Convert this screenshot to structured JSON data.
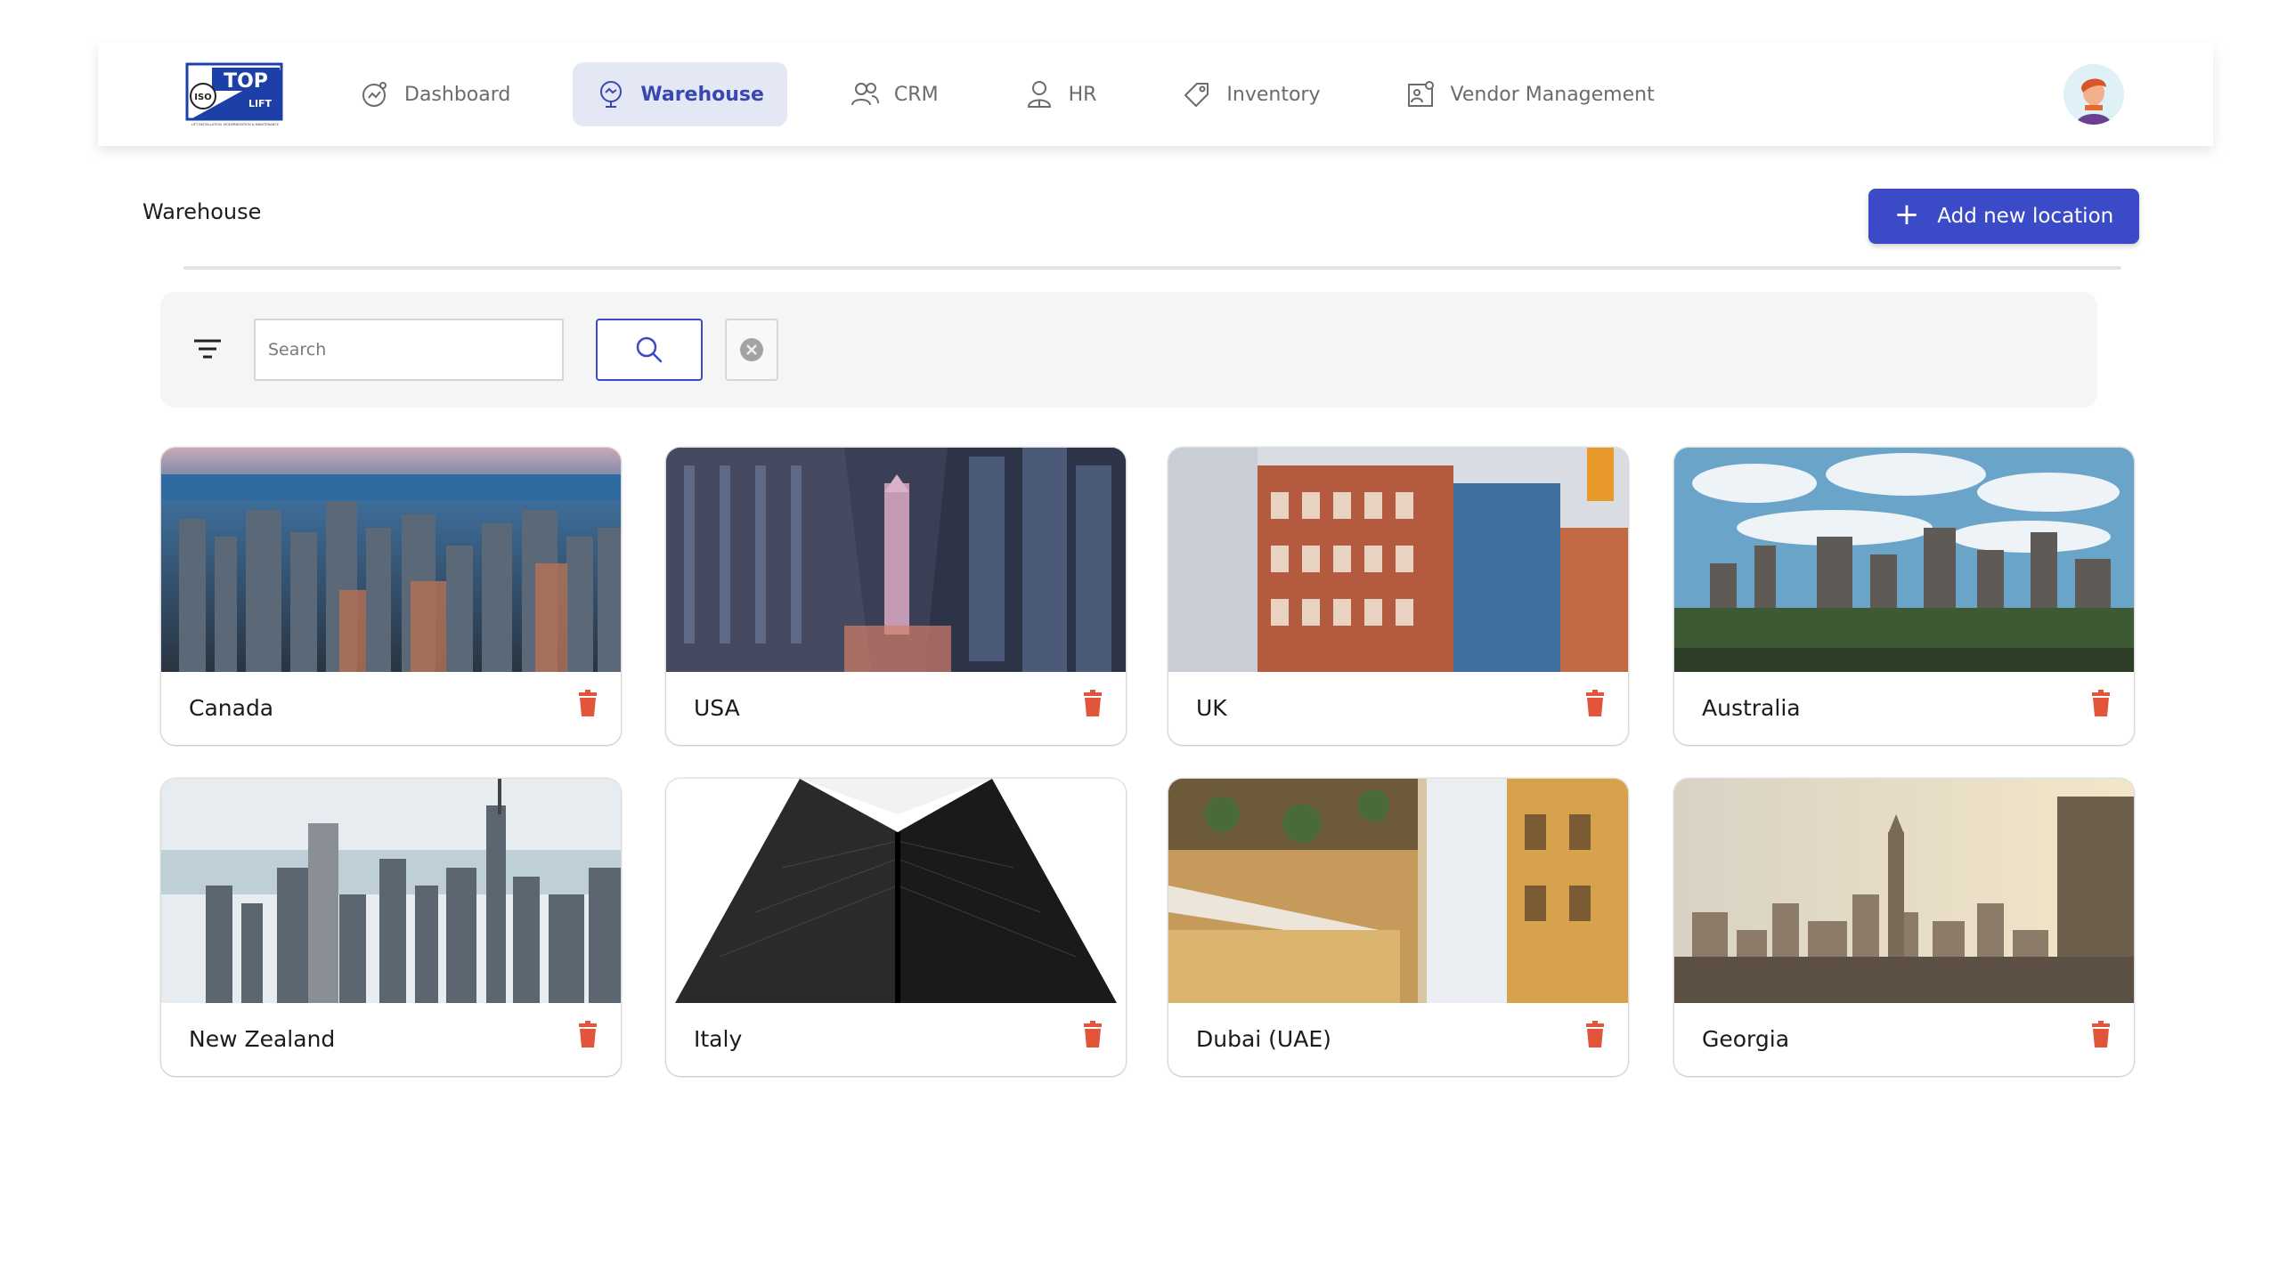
{
  "app": {
    "logo_text": "TOP",
    "logo_subtext": "LIFT",
    "logo_badge": "ISO",
    "logo_tagline": "LIFT INSTALLATION, MODERNIZATION & MAINTENANCE"
  },
  "nav": {
    "items": [
      {
        "label": "Dashboard",
        "icon": "dashboard-icon",
        "active": false
      },
      {
        "label": "Warehouse",
        "icon": "warehouse-icon",
        "active": true
      },
      {
        "label": "CRM",
        "icon": "users-icon",
        "active": false
      },
      {
        "label": "HR",
        "icon": "person-icon",
        "active": false
      },
      {
        "label": "Inventory",
        "icon": "tag-icon",
        "active": false
      },
      {
        "label": "Vendor Management",
        "icon": "vendor-icon",
        "active": false
      }
    ]
  },
  "page": {
    "title": "Warehouse",
    "add_button_label": "Add new location"
  },
  "filters": {
    "search_placeholder": "Search",
    "search_value": ""
  },
  "locations": [
    {
      "name": "Canada",
      "image": "city-skyline-lake"
    },
    {
      "name": "USA",
      "image": "downtown-street"
    },
    {
      "name": "UK",
      "image": "brick-buildings"
    },
    {
      "name": "Australia",
      "image": "city-skyline-clouds"
    },
    {
      "name": "New Zealand",
      "image": "aerial-city"
    },
    {
      "name": "Italy",
      "image": "skyscraper-upward"
    },
    {
      "name": "Dubai (UAE)",
      "image": "narrow-street"
    },
    {
      "name": "Georgia",
      "image": "skyline-sunset"
    }
  ],
  "colors": {
    "primary": "#3b4bc8",
    "nav_active_bg": "#e4e8f5",
    "delete_icon": "#e2553a"
  }
}
